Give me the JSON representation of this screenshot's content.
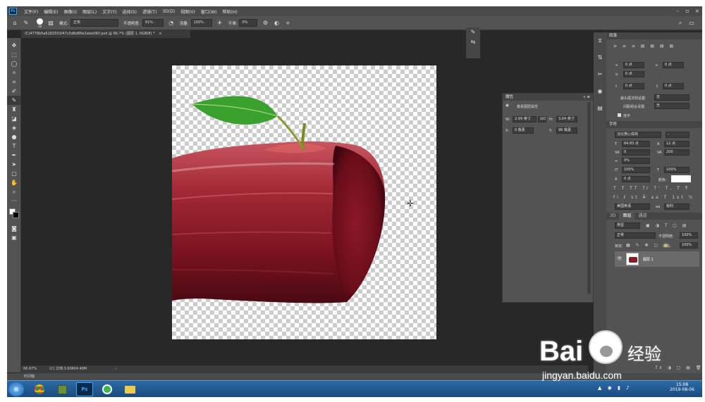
{
  "menubar": {
    "items": [
      "文件(F)",
      "编辑(E)",
      "图像(I)",
      "图层(L)",
      "文字(Y)",
      "选择(S)",
      "滤镜(T)",
      "3D(D)",
      "视图(V)",
      "窗口(W)",
      "帮助(H)"
    ]
  },
  "window_controls": {
    "minimize": "–",
    "restore": "▫",
    "close": "×"
  },
  "options_bar": {
    "brush_size": "28",
    "mode_label": "模式:",
    "mode_value": "正常",
    "opacity_label": "不透明度:",
    "opacity_value": "91%",
    "flow_label": "流量:",
    "flow_value": "100%",
    "smooth_label": "平滑:",
    "smooth_value": "0%"
  },
  "document_tab": {
    "title": "(C)4778b5a6182501f47c5d6d86e1ebe060.psd @ 66.7% (图层 1, RGB/8) *",
    "close": "×"
  },
  "tools": [
    "move-icon",
    "marquee-icon",
    "lasso-icon",
    "magic-wand-icon",
    "crop-icon",
    "eyedropper-icon",
    "brush-icon",
    "stamp-icon",
    "eraser-icon",
    "gradient-icon",
    "dodge-icon",
    "type-icon",
    "pen-icon",
    "path-select-icon",
    "shape-icon",
    "hand-icon",
    "zoom-icon",
    "more-icon"
  ],
  "status": {
    "zoom": "66.67%",
    "doc_info": "(C) 文档:3.60M/4.48M",
    "arrow": "›"
  },
  "timeline": {
    "label": "时间轴"
  },
  "properties_panel": {
    "title": "属性",
    "subtitle": "像素图层属性",
    "w_label": "W:",
    "w_value": "2.99 英寸",
    "link": "GO",
    "h_label": "H:",
    "h_value": "3.04 英寸",
    "x_label": "X:",
    "x_value": "0 像素",
    "y_label": "Y:",
    "y_value": "96 像素"
  },
  "paragraph_panel": {
    "title": "段落",
    "indent_left": "0 点",
    "indent_right": "0 点",
    "space_before": "0 点",
    "first_line": "0 点",
    "space_after": "0 点",
    "hyphen_label": "避头尾法则设置:",
    "hyphen_value": "无",
    "spacing_label": "间距组合设置:",
    "spacing_value": "无",
    "hyphenation": "连字"
  },
  "character_panel": {
    "title": "字符",
    "font_family": "汉仪菱心体简",
    "font_style": "-",
    "font_size": "64.83 点",
    "leading": "(自动)",
    "leading_short": "12 点",
    "kerning": "0",
    "tracking": "200",
    "scale_v": "0%",
    "scale_h_label": "100%",
    "scale_h2": "100%",
    "baseline": "0 点",
    "color_label": "颜色:",
    "glyphs_1": "T T TT Tr T' T, T Ŧ",
    "glyphs_2": "fi ℓ st Ā aa T 1st ½",
    "language": "美国英语",
    "aa": "锐利"
  },
  "layers_panel": {
    "tabs": [
      "3D",
      "图层",
      "通道"
    ],
    "filter": "类型",
    "blend": "正常",
    "opacity_label": "不透明度:",
    "opacity_value": "100%",
    "lock_label": "锁定:",
    "fill_label": "填充:",
    "fill_value": "100%",
    "layer_name": "图层 1"
  },
  "taskbar": {
    "time": "15:08",
    "date": "2019-08-06",
    "ps_label": "Ps"
  },
  "watermark": {
    "brand": "Bai",
    "brand2": "经验",
    "url": "jingyan.baidu.com"
  },
  "colors": {
    "accent": "#31a8ff",
    "ui_dark": "#282828",
    "panel": "#535353",
    "apple_red": "#8b1a24",
    "leaf_green": "#3a9a2c"
  }
}
